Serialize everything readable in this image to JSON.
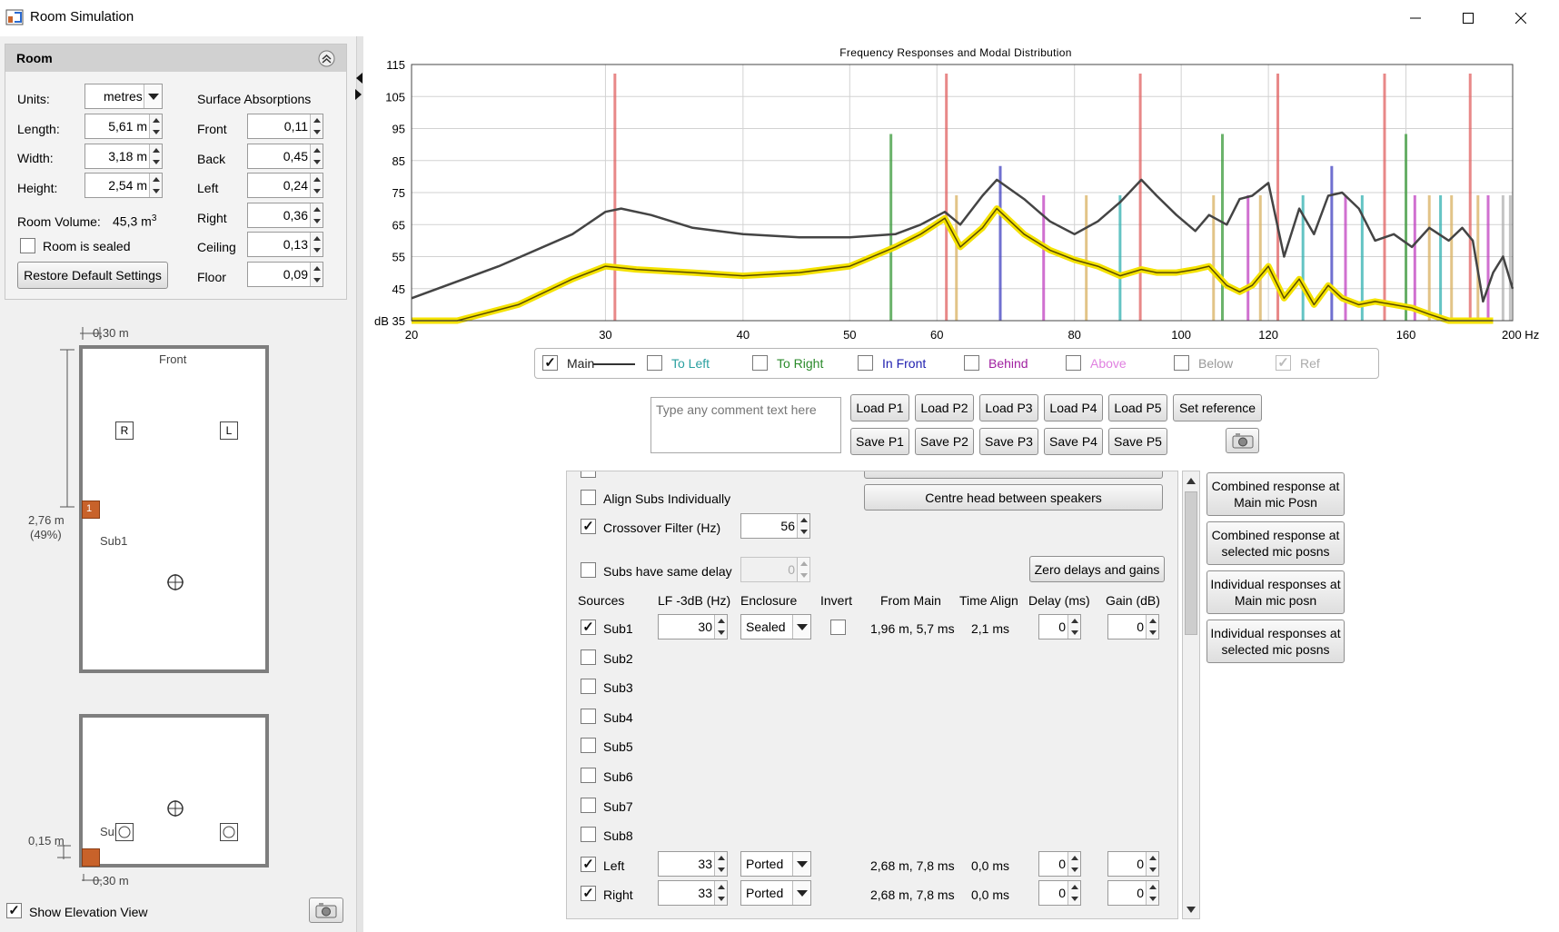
{
  "window": {
    "title": "Room Simulation"
  },
  "room": {
    "header": "Room",
    "units_label": "Units:",
    "units_value": "metres",
    "length_label": "Length:",
    "length_value": "5,61 m",
    "width_label": "Width:",
    "width_value": "3,18 m",
    "height_label": "Height:",
    "height_value": "2,54 m",
    "volume_label": "Room Volume:",
    "volume_value": "45,3 m",
    "volume_unit_sup": "3",
    "sealed_label": "Room is sealed",
    "restore_label": "Restore Default Settings",
    "surface_title": "Surface Absorptions",
    "surfaces": [
      {
        "label": "Front",
        "value": "0,11"
      },
      {
        "label": "Back",
        "value": "0,45"
      },
      {
        "label": "Left",
        "value": "0,24"
      },
      {
        "label": "Right",
        "value": "0,36"
      },
      {
        "label": "Ceiling",
        "value": "0,13"
      },
      {
        "label": "Floor",
        "value": "0,09"
      }
    ]
  },
  "plan_view": {
    "top_dim": "0,30 m",
    "front_label": "Front",
    "side_dim": "2,76 m",
    "side_dim_pct": "(49%)",
    "speaker_r": "R",
    "speaker_l": "L",
    "sub_label": "Sub1",
    "sub_marker": "1"
  },
  "elevation_view": {
    "height_dim": "0,15 m",
    "bottom_dim": "0,30 m",
    "sub_label": "Sub1"
  },
  "show_elevation": {
    "label": "Show Elevation View",
    "checked": true
  },
  "chart_data": {
    "type": "line",
    "title": "Frequency Responses and Modal Distribution",
    "ylabel": "dB",
    "xlabel_unit": "Hz",
    "x_scale": "log",
    "xlim": [
      20,
      200
    ],
    "ylim": [
      35,
      115
    ],
    "x_ticks": [
      20,
      30,
      40,
      50,
      60,
      80,
      100,
      120,
      160,
      200
    ],
    "x_tick_labels": [
      "20",
      "30",
      "40",
      "50",
      "60",
      "80",
      "100",
      "120",
      "160",
      "200 Hz"
    ],
    "y_ticks": [
      35,
      45,
      55,
      65,
      75,
      85,
      95,
      105,
      115
    ],
    "y_tick_labels": [
      "dB 35",
      "45",
      "55",
      "65",
      "75",
      "85",
      "95",
      "105",
      "115"
    ],
    "grid": true,
    "series": [
      {
        "name": "Ref",
        "color": "#444444",
        "x": [
          20,
          24,
          28,
          30,
          31,
          33,
          36,
          40,
          45,
          50,
          55,
          58,
          61,
          63,
          66,
          68,
          72,
          76,
          80,
          84,
          88,
          92,
          95,
          99,
          103,
          106,
          110,
          113,
          116,
          120,
          124,
          128,
          132,
          136,
          140,
          145,
          150,
          156,
          162,
          168,
          175,
          180,
          184,
          188,
          192,
          196,
          200
        ],
        "y": [
          42,
          52,
          62,
          69,
          70,
          68,
          64,
          62,
          61,
          61,
          62,
          65,
          69,
          65,
          74,
          79,
          73,
          66,
          62,
          66,
          72,
          79,
          74,
          68,
          63,
          68,
          65,
          73,
          74,
          78,
          55,
          70,
          62,
          74,
          75,
          70,
          60,
          62,
          58,
          64,
          60,
          64,
          60,
          41,
          50,
          55,
          45
        ]
      },
      {
        "name": "Main",
        "color": "#f4e200",
        "x": [
          20,
          22,
          25,
          28,
          30,
          32,
          36,
          40,
          45,
          50,
          55,
          58,
          61,
          63,
          66,
          68,
          72,
          76,
          80,
          84,
          88,
          92,
          95,
          99,
          103,
          106,
          110,
          113,
          116,
          120,
          124,
          128,
          132,
          136,
          140,
          145,
          150,
          156,
          162,
          168,
          175,
          180,
          184,
          188,
          192
        ],
        "y": [
          28,
          32,
          40,
          48,
          52,
          51,
          50,
          49,
          50,
          52,
          58,
          62,
          67,
          58,
          64,
          70,
          62,
          57,
          54,
          52,
          49,
          51,
          50,
          50,
          51,
          52,
          46,
          44,
          46,
          52,
          42,
          48,
          40,
          46,
          42,
          40,
          41,
          40,
          39,
          37,
          33,
          33,
          35,
          33,
          28
        ]
      }
    ],
    "modes": [
      {
        "x": 30.6,
        "color": "#e06060"
      },
      {
        "x": 54.5,
        "color": "#3a9a3a"
      },
      {
        "x": 61.2,
        "color": "#e06060"
      },
      {
        "x": 62.5,
        "color": "#d8b060"
      },
      {
        "x": 68.5,
        "color": "#4040c0"
      },
      {
        "x": 75,
        "color": "#c040c0"
      },
      {
        "x": 82,
        "color": "#d8b060"
      },
      {
        "x": 91.8,
        "color": "#e06060"
      },
      {
        "x": 88,
        "color": "#30b0b0"
      },
      {
        "x": 109,
        "color": "#3a9a3a"
      },
      {
        "x": 107,
        "color": "#d8b060"
      },
      {
        "x": 115,
        "color": "#c040c0"
      },
      {
        "x": 118,
        "color": "#d8b060"
      },
      {
        "x": 122.4,
        "color": "#e06060"
      },
      {
        "x": 129,
        "color": "#30b0b0"
      },
      {
        "x": 137,
        "color": "#4040c0"
      },
      {
        "x": 141,
        "color": "#c040c0"
      },
      {
        "x": 146,
        "color": "#30b0b0"
      },
      {
        "x": 153,
        "color": "#e06060"
      },
      {
        "x": 160,
        "color": "#3a9a3a"
      },
      {
        "x": 163,
        "color": "#c040c0"
      },
      {
        "x": 168,
        "color": "#d8b060"
      },
      {
        "x": 172,
        "color": "#30b0b0"
      },
      {
        "x": 176,
        "color": "#d8b060"
      },
      {
        "x": 183,
        "color": "#e06060"
      },
      {
        "x": 186,
        "color": "#d8b060"
      },
      {
        "x": 190,
        "color": "#c040c0"
      },
      {
        "x": 196,
        "color": "#b0b0b0"
      },
      {
        "x": 199,
        "color": "#b0b0b0"
      }
    ]
  },
  "legend": [
    {
      "label": "Main",
      "checked": true,
      "color": "#222222"
    },
    {
      "label": "To Left",
      "checked": false,
      "color": "#2aa0a0"
    },
    {
      "label": "To Right",
      "checked": false,
      "color": "#2a8a2a"
    },
    {
      "label": "In Front",
      "checked": false,
      "color": "#2020b0"
    },
    {
      "label": "Behind",
      "checked": false,
      "color": "#a020a0"
    },
    {
      "label": "Above",
      "checked": false,
      "color": "#e080e0"
    },
    {
      "label": "Below",
      "checked": false,
      "color": "#999999"
    },
    {
      "label": "Ref",
      "checked": true,
      "color": "#aaaaaa"
    }
  ],
  "comment": {
    "placeholder": "Type any comment text here"
  },
  "presets": {
    "load": [
      "Load P1",
      "Load P2",
      "Load P3",
      "Load P4",
      "Load P5"
    ],
    "save": [
      "Save P1",
      "Save P2",
      "Save P3",
      "Save P4",
      "Save P5"
    ],
    "set_reference": "Set reference"
  },
  "sources": {
    "centre_head": "Centre head between speakers",
    "align_subs": "Align Subs Individually",
    "crossover_label": "Crossover Filter (Hz)",
    "crossover_value": "56",
    "same_delay": "Subs have same delay",
    "same_delay_value": "0",
    "zero_delays": "Zero delays and gains",
    "headers": [
      "Sources",
      "LF -3dB (Hz)",
      "Enclosure",
      "Invert",
      "From Main",
      "Time Align",
      "Delay (ms)",
      "Gain (dB)"
    ],
    "rows": [
      {
        "name": "Sub1",
        "checked": true,
        "lf": "30",
        "enclosure": "Sealed",
        "from_main": "1,96 m, 5,7 ms",
        "time_align": "2,1 ms",
        "delay": "0",
        "gain": "0",
        "show": true,
        "invert": true
      },
      {
        "name": "Sub2",
        "checked": false,
        "show": false
      },
      {
        "name": "Sub3",
        "checked": false,
        "show": false
      },
      {
        "name": "Sub4",
        "checked": false,
        "show": false
      },
      {
        "name": "Sub5",
        "checked": false,
        "show": false
      },
      {
        "name": "Sub6",
        "checked": false,
        "show": false
      },
      {
        "name": "Sub7",
        "checked": false,
        "show": false
      },
      {
        "name": "Sub8",
        "checked": false,
        "show": false
      },
      {
        "name": "Left",
        "checked": true,
        "lf": "33",
        "enclosure": "Ported",
        "from_main": "2,68 m, 7,8 ms",
        "time_align": "0,0 ms",
        "delay": "0",
        "gain": "0",
        "show": true,
        "invert": false
      },
      {
        "name": "Right",
        "checked": true,
        "lf": "33",
        "enclosure": "Ported",
        "from_main": "2,68 m, 7,8 ms",
        "time_align": "0,0 ms",
        "delay": "0",
        "gain": "0",
        "show": true,
        "invert": false
      }
    ]
  },
  "response_buttons": [
    "Combined response at\nMain mic Posn",
    "Combined response at\nselected mic posns",
    "Individual responses at\nMain mic posn",
    "Individual responses at\nselected mic posns"
  ]
}
